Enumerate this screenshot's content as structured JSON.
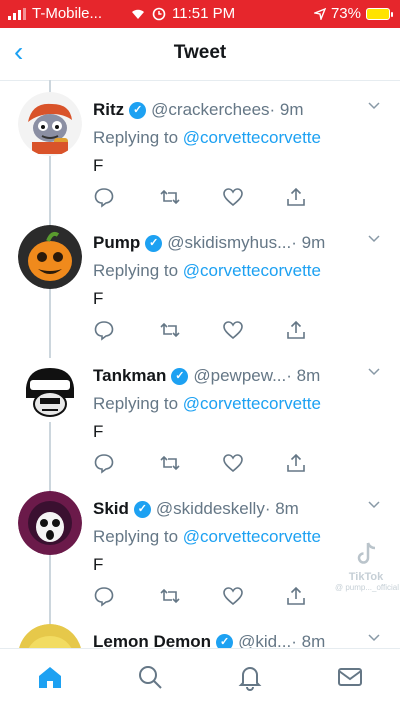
{
  "status_bar": {
    "carrier": "T-Mobile...",
    "time": "11:51 PM",
    "battery": "73%"
  },
  "header": {
    "back_icon": "chevron-left-icon",
    "title": "Tweet"
  },
  "tweets": [
    {
      "name": "Ritz",
      "handle": "@crackerchees",
      "time": "· 9m",
      "reply_prefix": "Replying to ",
      "reply_to": "@corvettecorvette",
      "text": "F"
    },
    {
      "name": "Pump",
      "handle": "@skidismyhus...",
      "time": "· 9m",
      "reply_prefix": "Replying to ",
      "reply_to": "@corvettecorvette",
      "text": "F"
    },
    {
      "name": "Tankman",
      "handle": "@pewpew...",
      "time": "· 8m",
      "reply_prefix": "Replying to ",
      "reply_to": "@corvettecorvette",
      "text": "F"
    },
    {
      "name": "Skid",
      "handle": "@skiddeskelly",
      "time": "· 8m",
      "reply_prefix": "Replying to ",
      "reply_to": "@corvettecorvette",
      "text": "F"
    },
    {
      "name": "Lemon Demon",
      "handle": "@kid...",
      "time": "· 8m"
    }
  ],
  "watermark": {
    "brand": "TikTok",
    "user": "@ pump..._official"
  },
  "tab_bar": [
    "home-icon",
    "search-icon",
    "notifications-icon",
    "messages-icon"
  ],
  "colors": {
    "accent": "#1da1f2",
    "status_bar": "#e6262c",
    "secondary_text": "#657786"
  }
}
